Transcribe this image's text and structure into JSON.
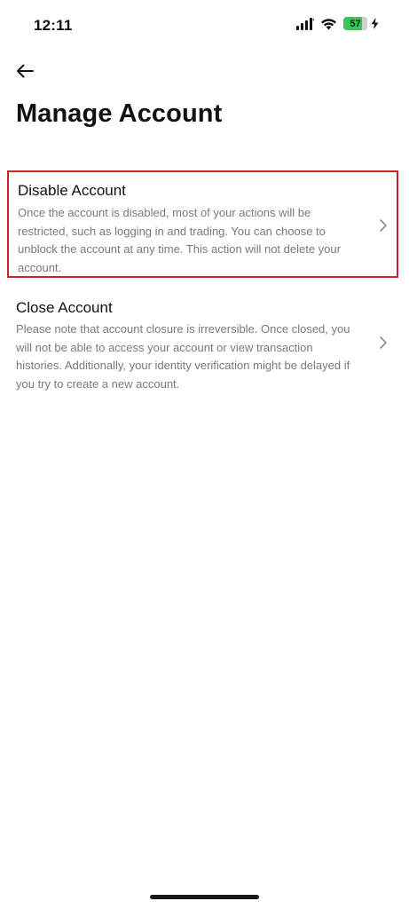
{
  "status_bar": {
    "time": "12:11",
    "battery_level": "57",
    "battery_color": "#34c759"
  },
  "header": {
    "back_icon": "arrow-left-icon",
    "title": "Manage Account"
  },
  "options": [
    {
      "title": "Disable Account",
      "description": "Once the account is disabled, most of your actions will be restricted, such as logging in and trading. You can choose to unblock the account at any time. This action will not delete your account.",
      "highlighted": true,
      "highlight_color": "#d21f2e"
    },
    {
      "title": "Close Account",
      "description": "Please note that account closure is irreversible. Once closed, you will not be able to access your account or view transaction histories. Additionally, your identity verification might be delayed if you try to create a new account.",
      "highlighted": false
    }
  ]
}
